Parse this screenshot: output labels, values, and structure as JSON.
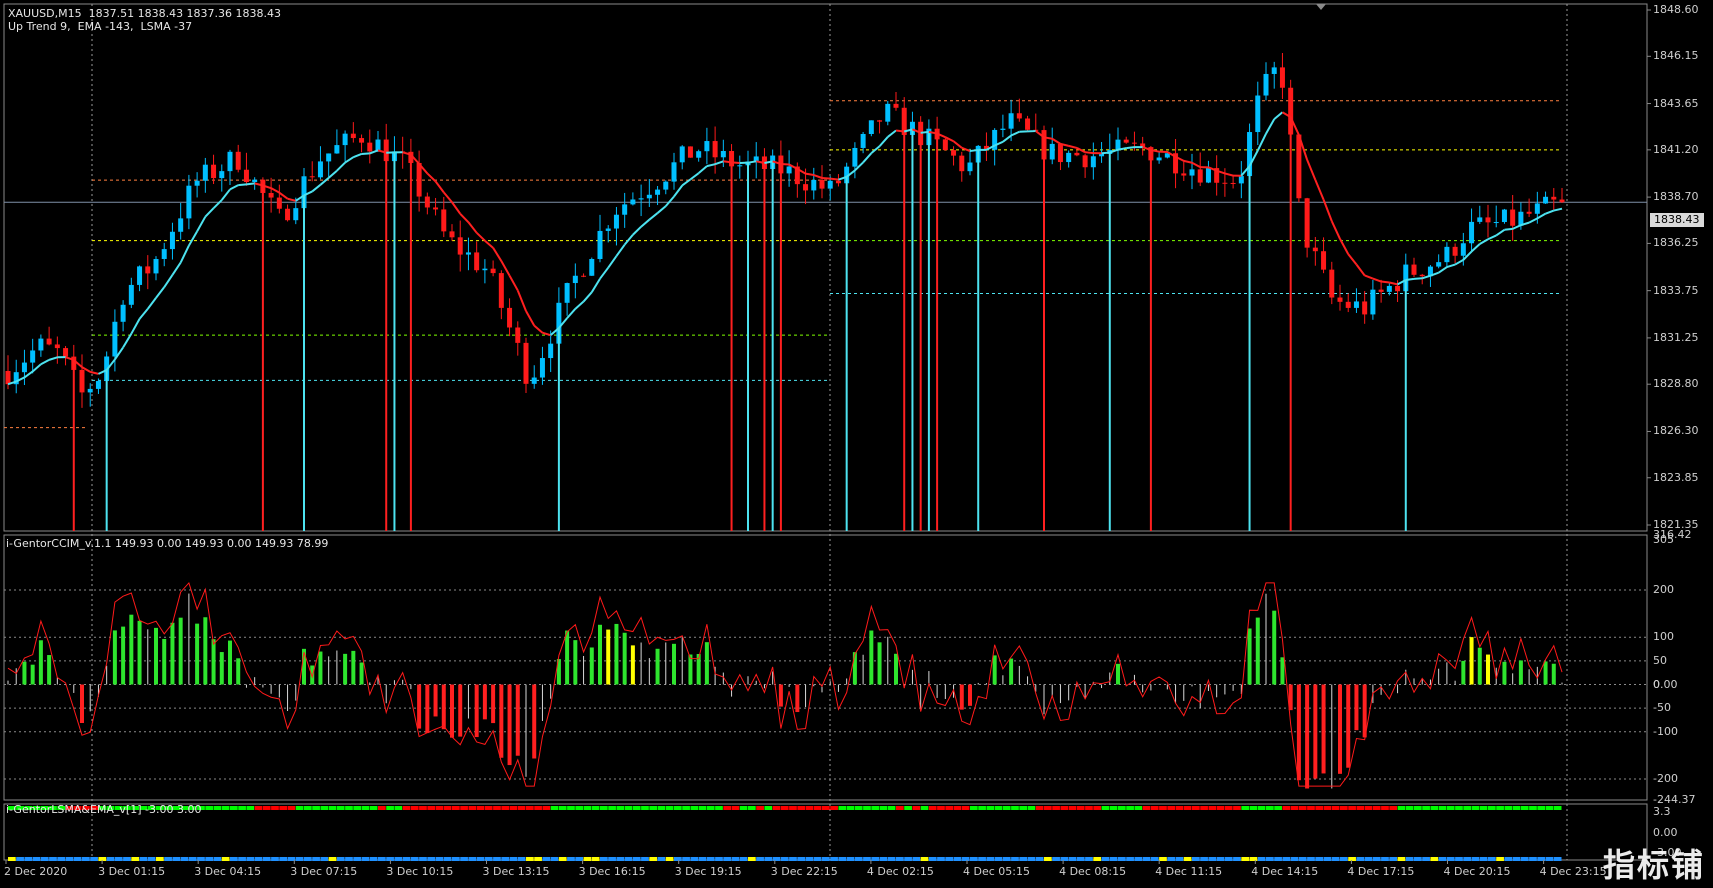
{
  "symbol_line": "XAUUSD,M15  1837.51 1838.43 1837.36 1838.43",
  "indicator_line": "Up Trend 9,  EMA -143,  LSMA -37",
  "cci_title": "i-GentorCCIM_v.1.1 149.93 0.00 149.93 0.00 149.93 78.99",
  "lsma_title": "i-GentorLSMA&EMA_v[1] -3.00 3.00",
  "current_price": "1838.43",
  "watermark": "指标铺",
  "price_axis": [
    "1848.60",
    "1846.15",
    "1843.65",
    "1841.20",
    "1838.70",
    "1836.25",
    "1833.75",
    "1831.25",
    "1828.80",
    "1826.30",
    "1823.85",
    "1821.35"
  ],
  "cci_axis": [
    "316.42",
    "305",
    "200",
    "100",
    "50",
    "0.00",
    "0",
    "-50",
    "-100",
    "-200",
    "-244.37"
  ],
  "lsma_axis": [
    "3.3",
    "0.00",
    "-3.00"
  ],
  "time_axis": [
    "2 Dec 2020",
    "3 Dec 01:15",
    "3 Dec 04:15",
    "3 Dec 07:15",
    "3 Dec 10:15",
    "3 Dec 13:15",
    "3 Dec 16:15",
    "3 Dec 19:15",
    "3 Dec 22:15",
    "4 Dec 02:15",
    "4 Dec 05:15",
    "4 Dec 08:15",
    "4 Dec 11:15",
    "4 Dec 14:15",
    "4 Dec 17:15",
    "4 Dec 20:15",
    "4 Dec 23:15"
  ],
  "colors": {
    "bull": "#00bfff",
    "bear": "#ff1a1a",
    "trend_up": "#4de3f0",
    "trend_down": "#ff2020",
    "cci_green": "#2ee52e",
    "cci_red": "#ff2020",
    "cci_white": "#d8d8d8",
    "cci_yellow": "#ffff00",
    "lsma_green": "#00ff00",
    "lsma_red": "#ff0000",
    "ema_blue": "#1e90ff",
    "ema_yellow": "#ffff00"
  },
  "chart_data": {
    "type": "candlestick",
    "title": "XAUUSD,M15",
    "ylim": [
      1821.35,
      1848.6
    ],
    "last_close": 1838.43,
    "open": 1837.51,
    "high": 1838.43,
    "low": 1837.36
  }
}
